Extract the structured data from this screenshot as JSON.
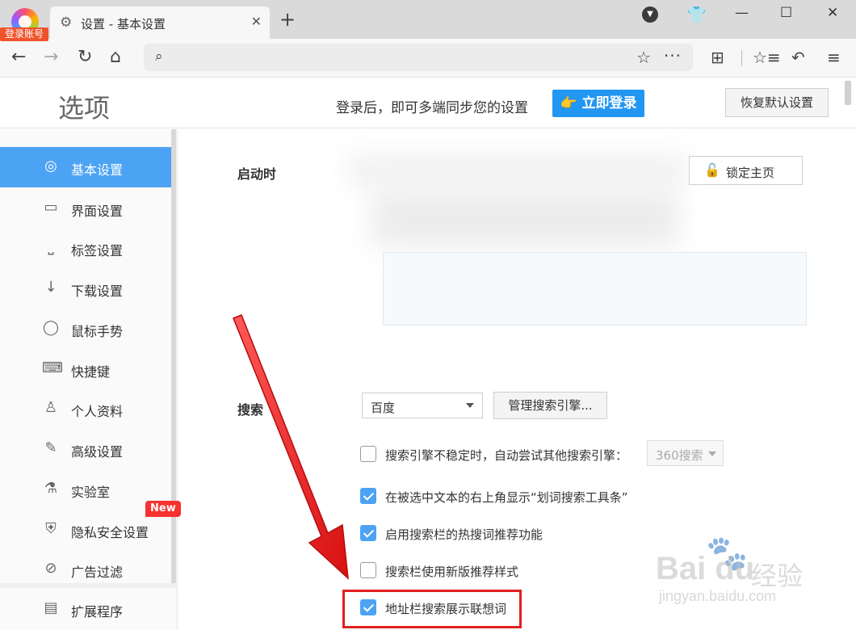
{
  "titlebar": {
    "login_badge": "登录账号",
    "tab_title": "设置 - 基本设置",
    "tab_close": "✕",
    "new_tab": "+",
    "window_controls": {
      "minimize": "—",
      "maximize": "☐",
      "close": "✕"
    }
  },
  "navbar": {
    "back": "←",
    "forward": "→",
    "reload": "↻",
    "home": "⌂",
    "address_value": "",
    "star": "☆",
    "more": "···",
    "apps": "⊞",
    "favorites": "☆≡",
    "undo": "↶",
    "menu": "≡"
  },
  "header": {
    "title": "选项",
    "login_hint": "登录后，即可多端同步您的设置",
    "login_button": "👉 立即登录",
    "restore_button": "恢复默认设置"
  },
  "sidebar": {
    "items": [
      {
        "icon": "◎",
        "label": "基本设置",
        "active": true
      },
      {
        "icon": "▭",
        "label": "界面设置"
      },
      {
        "icon": "⎵",
        "label": "标签设置"
      },
      {
        "icon": "↓",
        "label": "下载设置"
      },
      {
        "icon": "◯",
        "label": "鼠标手势"
      },
      {
        "icon": "⌨",
        "label": "快捷键"
      },
      {
        "icon": "♙",
        "label": "个人资料"
      },
      {
        "icon": "✎",
        "label": "高级设置"
      },
      {
        "icon": "⚗",
        "label": "实验室"
      },
      {
        "icon": "⛨",
        "label": "隐私安全设置"
      },
      {
        "icon": "⊘",
        "label": "广告过滤"
      },
      {
        "icon": "▤",
        "label": "扩展程序"
      }
    ],
    "new_badge": "New"
  },
  "startup": {
    "label": "启动时",
    "lock_icon": "🔓",
    "lock_button": "锁定主页"
  },
  "search": {
    "label": "搜索",
    "engine_selected": "百度",
    "manage_button": "管理搜索引擎...",
    "fallback_engine": "360搜索",
    "options": [
      {
        "label": "搜索引擎不稳定时，自动尝试其他搜索引擎：",
        "checked": false
      },
      {
        "label": "在被选中文本的右上角显示“划词搜索工具条”",
        "checked": true
      },
      {
        "label": "启用搜索栏的热搜词推荐功能",
        "checked": true
      },
      {
        "label": "搜索栏使用新版推荐样式",
        "checked": false
      },
      {
        "label": "地址栏搜索展示联想词",
        "checked": true
      }
    ]
  },
  "watermark": {
    "logo": "Bai du",
    "cn": "经验",
    "url": "jingyan.baidu.com"
  },
  "colors": {
    "accent": "#4da3f3",
    "login": "#2196f3",
    "annotation": "#e02020",
    "badge": "#f5322f"
  }
}
